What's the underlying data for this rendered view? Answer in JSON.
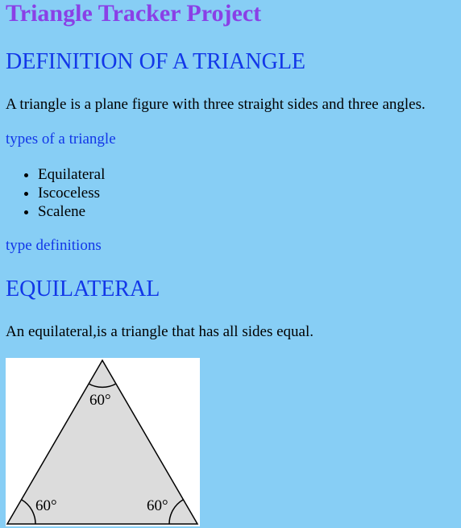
{
  "site": {
    "title": "Triangle Tracker Project"
  },
  "definition": {
    "heading": "DEFINITION OF A TRIANGLE",
    "text": "A triangle is a plane figure with three straight sides and three angles."
  },
  "types": {
    "label": "types of a triangle",
    "items": [
      "Equilateral",
      "Iscoceless",
      "Scalene"
    ]
  },
  "type_definitions": {
    "label": "type definitions"
  },
  "equilateral": {
    "heading": "EQUILATERAL",
    "text": "An equilateral,is a triangle that has all sides equal.",
    "figure": {
      "angle_top": "60°",
      "angle_left": "60°",
      "angle_right": "60°"
    }
  },
  "colors": {
    "background": "#87cef5",
    "title": "#8a40e6",
    "heading": "#1237e8",
    "triangle_fill": "#dcdcdc"
  }
}
